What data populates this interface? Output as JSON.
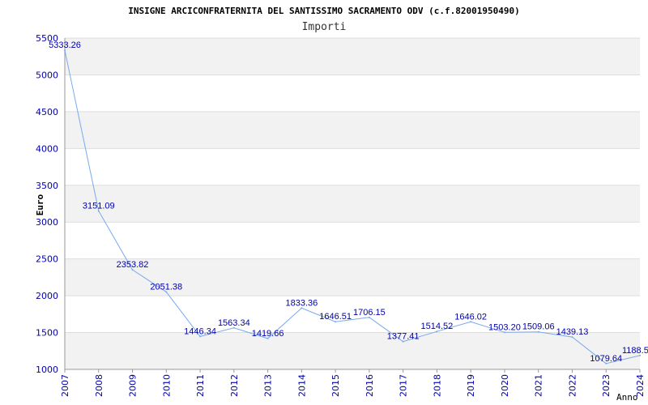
{
  "chart_data": {
    "type": "line",
    "title": "INSIGNE ARCICONFRATERNITA DEL SANTISSIMO SACRAMENTO ODV (c.f.82001950490)",
    "subtitle": "Importi",
    "ylabel": "Euro",
    "xlabel": "Anno",
    "ylim": [
      1000,
      5500
    ],
    "yticks": [
      1000,
      1500,
      2000,
      2500,
      3000,
      3500,
      4000,
      4500,
      5000,
      5500
    ],
    "categories": [
      "2007",
      "2008",
      "2009",
      "2010",
      "2011",
      "2012",
      "2013",
      "2014",
      "2015",
      "2016",
      "2017",
      "2018",
      "2019",
      "2020",
      "2021",
      "2022",
      "2023",
      "2024"
    ],
    "values": [
      5333.26,
      3151.09,
      2353.82,
      2051.38,
      1446.34,
      1563.34,
      1419.66,
      1833.36,
      1646.51,
      1706.15,
      1377.41,
      1514.52,
      1646.02,
      1503.2,
      1509.06,
      1439.13,
      1079.64,
      1188.5
    ],
    "data_labels": [
      "5333.26",
      "3151.09",
      "2353.82",
      "2051.38",
      "1446.34",
      "1563.34",
      "1419.66",
      "1833.36",
      "1646.51",
      "1706.15",
      "1377.41",
      "1514.52",
      "1646.02",
      "1503.20",
      "1509.06",
      "1439.13",
      "1079.64",
      "1188.5"
    ],
    "grid": true,
    "colors": {
      "line": "#77aaee",
      "band": "#f2f2f2",
      "grid": "#dddddd",
      "axis": "#999999",
      "tick_text": "#0000aa"
    }
  }
}
